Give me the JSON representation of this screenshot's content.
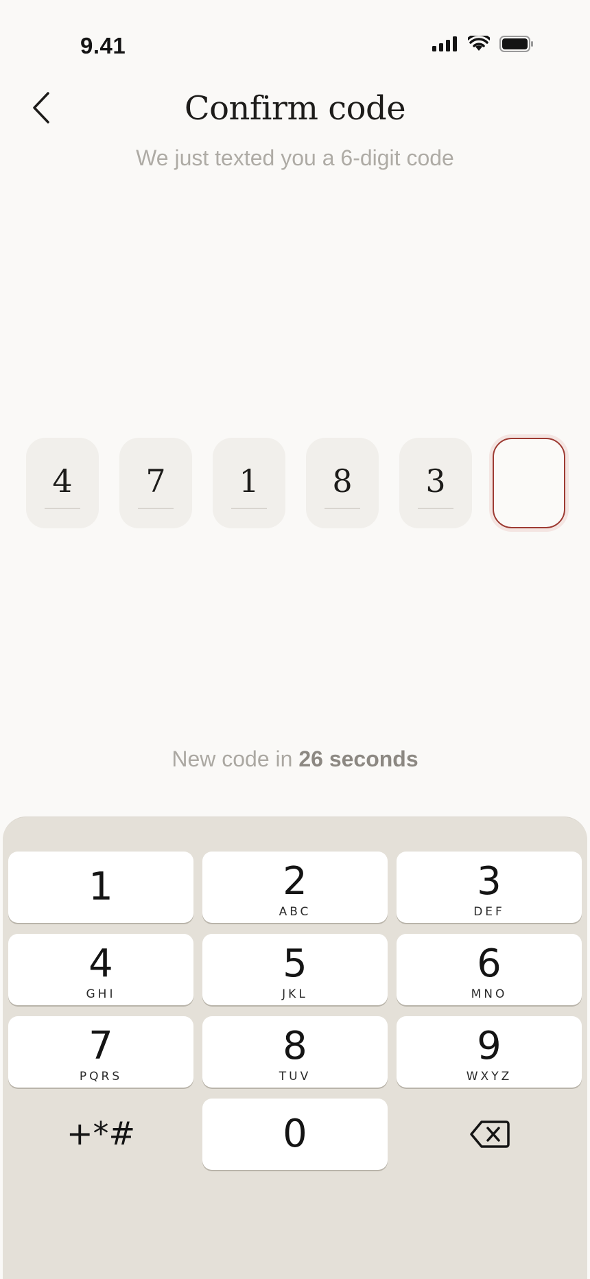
{
  "status_bar": {
    "time": "9.41",
    "icons": [
      "cellular-signal-icon",
      "wifi-icon",
      "battery-icon"
    ]
  },
  "header": {
    "back_icon": "chevron-left-icon",
    "title": "Confirm code",
    "subtitle": "We just texted you a 6-digit code"
  },
  "code": {
    "length": 6,
    "digits": [
      "4",
      "7",
      "1",
      "8",
      "3",
      ""
    ],
    "active_index": 5
  },
  "resend": {
    "prefix": "New code in ",
    "countdown": "26 seconds"
  },
  "keypad": {
    "keys": [
      {
        "num": "1",
        "letters": ""
      },
      {
        "num": "2",
        "letters": "ABC"
      },
      {
        "num": "3",
        "letters": "DEF"
      },
      {
        "num": "4",
        "letters": "GHI"
      },
      {
        "num": "5",
        "letters": "JKL"
      },
      {
        "num": "6",
        "letters": "MNO"
      },
      {
        "num": "7",
        "letters": "PQRS"
      },
      {
        "num": "8",
        "letters": "TUV"
      },
      {
        "num": "9",
        "letters": "WXYZ"
      },
      {
        "num": "0",
        "letters": ""
      }
    ],
    "symbols_label": "+*#",
    "backspace_icon": "backspace-icon"
  },
  "colors": {
    "background": "#faf9f7",
    "accent": "#9d3b33",
    "keypad_bg": "#e4e0d8",
    "muted_text": "#aeaba5"
  }
}
